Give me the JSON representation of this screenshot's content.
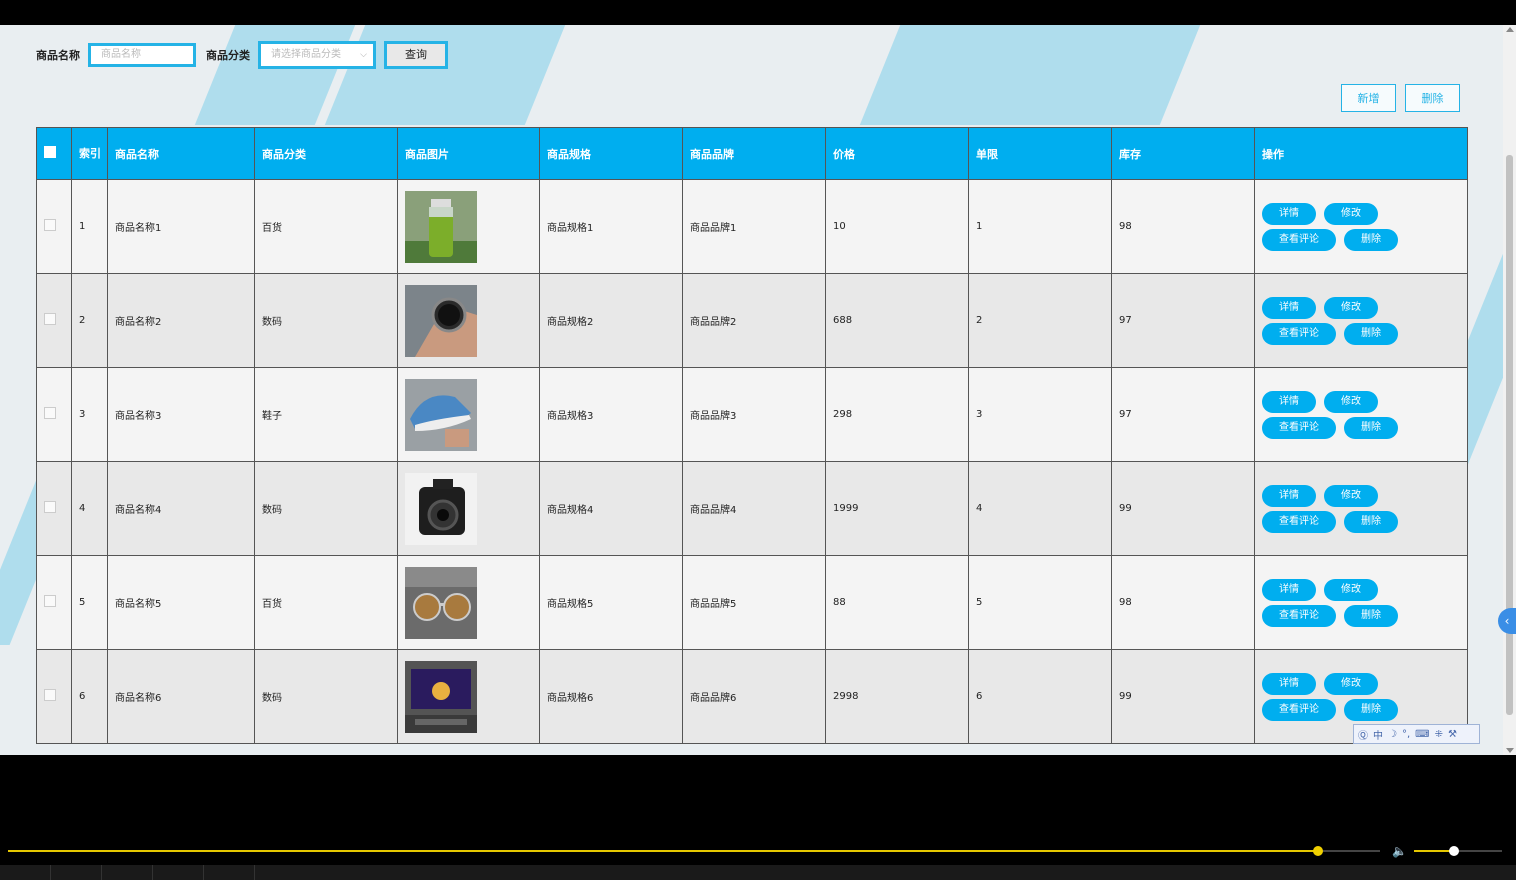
{
  "search": {
    "name_label": "商品名称",
    "name_placeholder": "商品名称",
    "category_label": "商品分类",
    "category_placeholder": "请选择商品分类",
    "query_button": "查询"
  },
  "actions": {
    "add": "新增",
    "delete": "删除"
  },
  "table": {
    "headers": {
      "index": "索引",
      "name": "商品名称",
      "category": "商品分类",
      "image": "商品图片",
      "spec": "商品规格",
      "brand": "商品品牌",
      "price": "价格",
      "limit": "单限",
      "stock": "库存",
      "ops": "操作"
    },
    "row_buttons": {
      "detail": "详情",
      "edit": "修改",
      "comments": "查看评论",
      "delete": "删除"
    },
    "rows": [
      {
        "index": "1",
        "name": "商品名称1",
        "category": "百货",
        "spec": "商品规格1",
        "brand": "商品品牌1",
        "price": "10",
        "limit": "1",
        "stock": "98",
        "image": "green-bottle"
      },
      {
        "index": "2",
        "name": "商品名称2",
        "category": "数码",
        "spec": "商品规格2",
        "brand": "商品品牌2",
        "price": "688",
        "limit": "2",
        "stock": "97",
        "image": "wristwatch"
      },
      {
        "index": "3",
        "name": "商品名称3",
        "category": "鞋子",
        "spec": "商品规格3",
        "brand": "商品品牌3",
        "price": "298",
        "limit": "3",
        "stock": "97",
        "image": "sneaker"
      },
      {
        "index": "4",
        "name": "商品名称4",
        "category": "数码",
        "spec": "商品规格4",
        "brand": "商品品牌4",
        "price": "1999",
        "limit": "4",
        "stock": "99",
        "image": "camera"
      },
      {
        "index": "5",
        "name": "商品名称5",
        "category": "百货",
        "spec": "商品规格5",
        "brand": "商品品牌5",
        "price": "88",
        "limit": "5",
        "stock": "98",
        "image": "sunglasses"
      },
      {
        "index": "6",
        "name": "商品名称6",
        "category": "数码",
        "spec": "商品规格6",
        "brand": "商品品牌6",
        "price": "2998",
        "limit": "6",
        "stock": "99",
        "image": "television"
      }
    ]
  },
  "ime": {
    "mode": "中"
  },
  "player": {
    "progress": 0.955,
    "volume": 0.45
  },
  "colors": {
    "accent": "#00aeef",
    "progress": "#e5c700"
  }
}
